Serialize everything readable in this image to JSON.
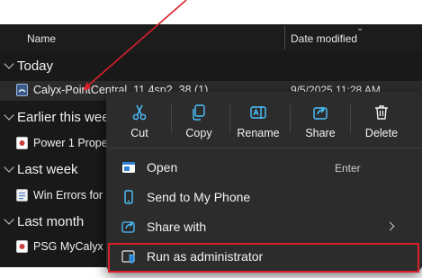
{
  "header": {
    "name_label": "Name",
    "date_label": "Date modified"
  },
  "groups": {
    "today": "Today",
    "earlier": "Earlier this wee",
    "last_week": "Last week",
    "last_month": "Last month"
  },
  "files": [
    {
      "name": "Calyx-PointCentral_11.4sp2_38 (1)",
      "date": "9/5/2025 11:28 AM"
    },
    {
      "name": "Power 1 Prope",
      "date": ""
    },
    {
      "name": "Win Errors for C",
      "date": ""
    },
    {
      "name": "PSG MyCalyx T",
      "date": ""
    }
  ],
  "toolbar": {
    "cut": "Cut",
    "copy": "Copy",
    "rename": "Rename",
    "share": "Share",
    "delete": "Delete"
  },
  "menu": {
    "open": {
      "label": "Open",
      "shortcut": "Enter"
    },
    "send_to_phone": "Send to My Phone",
    "share_with": "Share with",
    "run_as_admin": "Run as administrator"
  },
  "colors": {
    "annotation_red": "#d9202a",
    "accent_blue": "#4cc2ff",
    "menu_bg": "#2c2c2c",
    "explorer_bg": "#191919"
  }
}
